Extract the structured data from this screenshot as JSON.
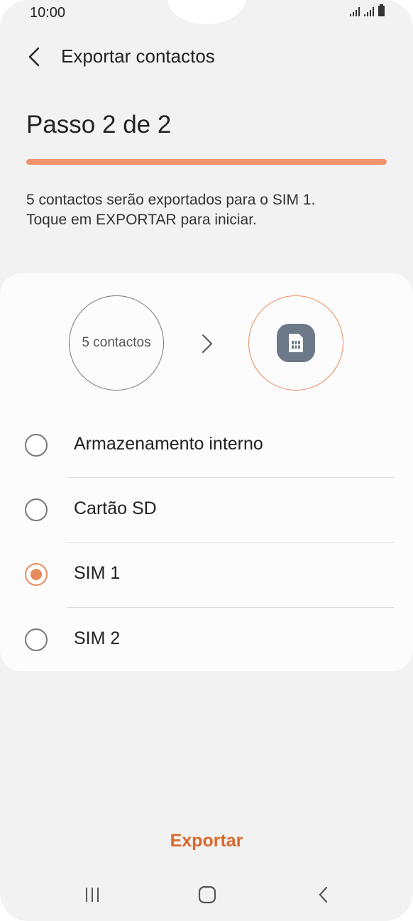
{
  "status_bar": {
    "time": "10:00"
  },
  "header": {
    "title": "Exportar contactos"
  },
  "step": {
    "title": "Passo 2 de 2",
    "progress_percent": 100
  },
  "description": {
    "line1": "5 contactos serão exportados para o SIM 1.",
    "line2": "Toque em EXPORTAR para iniciar."
  },
  "transfer": {
    "source_label": "5 contactos",
    "target_icon": "sim-card-icon"
  },
  "options": [
    {
      "label": "Armazenamento interno",
      "selected": false
    },
    {
      "label": "Cartão SD",
      "selected": false
    },
    {
      "label": "SIM 1",
      "selected": true
    },
    {
      "label": "SIM 2",
      "selected": false
    }
  ],
  "actions": {
    "export_label": "Exportar"
  },
  "colors": {
    "accent": "#e78b5e",
    "export_text": "#d9692c",
    "progress": "#f0926a",
    "sim_badge": "#6d7889"
  },
  "navigation_bar": {
    "icons": [
      "recent-apps-icon",
      "home-icon",
      "back-icon"
    ]
  }
}
